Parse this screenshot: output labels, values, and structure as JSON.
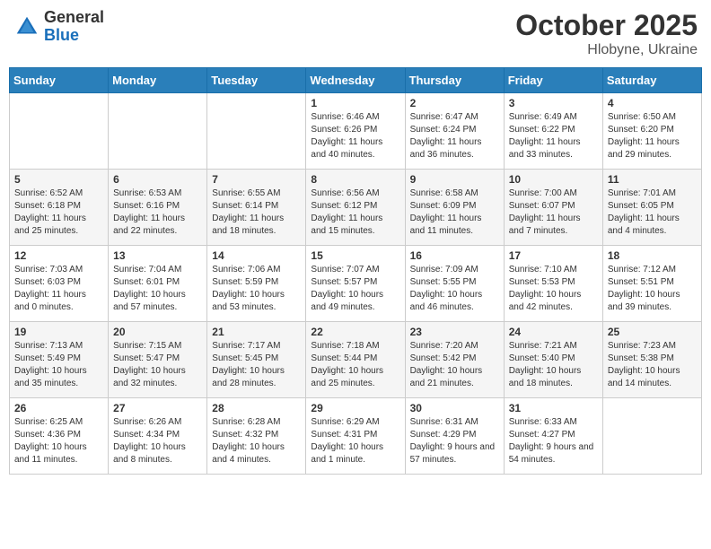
{
  "header": {
    "logo_general": "General",
    "logo_blue": "Blue",
    "month": "October 2025",
    "location": "Hlobyne, Ukraine"
  },
  "weekdays": [
    "Sunday",
    "Monday",
    "Tuesday",
    "Wednesday",
    "Thursday",
    "Friday",
    "Saturday"
  ],
  "weeks": [
    [
      null,
      null,
      null,
      {
        "day": "1",
        "sunrise": "Sunrise: 6:46 AM",
        "sunset": "Sunset: 6:26 PM",
        "daylight": "Daylight: 11 hours and 40 minutes."
      },
      {
        "day": "2",
        "sunrise": "Sunrise: 6:47 AM",
        "sunset": "Sunset: 6:24 PM",
        "daylight": "Daylight: 11 hours and 36 minutes."
      },
      {
        "day": "3",
        "sunrise": "Sunrise: 6:49 AM",
        "sunset": "Sunset: 6:22 PM",
        "daylight": "Daylight: 11 hours and 33 minutes."
      },
      {
        "day": "4",
        "sunrise": "Sunrise: 6:50 AM",
        "sunset": "Sunset: 6:20 PM",
        "daylight": "Daylight: 11 hours and 29 minutes."
      }
    ],
    [
      {
        "day": "5",
        "sunrise": "Sunrise: 6:52 AM",
        "sunset": "Sunset: 6:18 PM",
        "daylight": "Daylight: 11 hours and 25 minutes."
      },
      {
        "day": "6",
        "sunrise": "Sunrise: 6:53 AM",
        "sunset": "Sunset: 6:16 PM",
        "daylight": "Daylight: 11 hours and 22 minutes."
      },
      {
        "day": "7",
        "sunrise": "Sunrise: 6:55 AM",
        "sunset": "Sunset: 6:14 PM",
        "daylight": "Daylight: 11 hours and 18 minutes."
      },
      {
        "day": "8",
        "sunrise": "Sunrise: 6:56 AM",
        "sunset": "Sunset: 6:12 PM",
        "daylight": "Daylight: 11 hours and 15 minutes."
      },
      {
        "day": "9",
        "sunrise": "Sunrise: 6:58 AM",
        "sunset": "Sunset: 6:09 PM",
        "daylight": "Daylight: 11 hours and 11 minutes."
      },
      {
        "day": "10",
        "sunrise": "Sunrise: 7:00 AM",
        "sunset": "Sunset: 6:07 PM",
        "daylight": "Daylight: 11 hours and 7 minutes."
      },
      {
        "day": "11",
        "sunrise": "Sunrise: 7:01 AM",
        "sunset": "Sunset: 6:05 PM",
        "daylight": "Daylight: 11 hours and 4 minutes."
      }
    ],
    [
      {
        "day": "12",
        "sunrise": "Sunrise: 7:03 AM",
        "sunset": "Sunset: 6:03 PM",
        "daylight": "Daylight: 11 hours and 0 minutes."
      },
      {
        "day": "13",
        "sunrise": "Sunrise: 7:04 AM",
        "sunset": "Sunset: 6:01 PM",
        "daylight": "Daylight: 10 hours and 57 minutes."
      },
      {
        "day": "14",
        "sunrise": "Sunrise: 7:06 AM",
        "sunset": "Sunset: 5:59 PM",
        "daylight": "Daylight: 10 hours and 53 minutes."
      },
      {
        "day": "15",
        "sunrise": "Sunrise: 7:07 AM",
        "sunset": "Sunset: 5:57 PM",
        "daylight": "Daylight: 10 hours and 49 minutes."
      },
      {
        "day": "16",
        "sunrise": "Sunrise: 7:09 AM",
        "sunset": "Sunset: 5:55 PM",
        "daylight": "Daylight: 10 hours and 46 minutes."
      },
      {
        "day": "17",
        "sunrise": "Sunrise: 7:10 AM",
        "sunset": "Sunset: 5:53 PM",
        "daylight": "Daylight: 10 hours and 42 minutes."
      },
      {
        "day": "18",
        "sunrise": "Sunrise: 7:12 AM",
        "sunset": "Sunset: 5:51 PM",
        "daylight": "Daylight: 10 hours and 39 minutes."
      }
    ],
    [
      {
        "day": "19",
        "sunrise": "Sunrise: 7:13 AM",
        "sunset": "Sunset: 5:49 PM",
        "daylight": "Daylight: 10 hours and 35 minutes."
      },
      {
        "day": "20",
        "sunrise": "Sunrise: 7:15 AM",
        "sunset": "Sunset: 5:47 PM",
        "daylight": "Daylight: 10 hours and 32 minutes."
      },
      {
        "day": "21",
        "sunrise": "Sunrise: 7:17 AM",
        "sunset": "Sunset: 5:45 PM",
        "daylight": "Daylight: 10 hours and 28 minutes."
      },
      {
        "day": "22",
        "sunrise": "Sunrise: 7:18 AM",
        "sunset": "Sunset: 5:44 PM",
        "daylight": "Daylight: 10 hours and 25 minutes."
      },
      {
        "day": "23",
        "sunrise": "Sunrise: 7:20 AM",
        "sunset": "Sunset: 5:42 PM",
        "daylight": "Daylight: 10 hours and 21 minutes."
      },
      {
        "day": "24",
        "sunrise": "Sunrise: 7:21 AM",
        "sunset": "Sunset: 5:40 PM",
        "daylight": "Daylight: 10 hours and 18 minutes."
      },
      {
        "day": "25",
        "sunrise": "Sunrise: 7:23 AM",
        "sunset": "Sunset: 5:38 PM",
        "daylight": "Daylight: 10 hours and 14 minutes."
      }
    ],
    [
      {
        "day": "26",
        "sunrise": "Sunrise: 6:25 AM",
        "sunset": "Sunset: 4:36 PM",
        "daylight": "Daylight: 10 hours and 11 minutes."
      },
      {
        "day": "27",
        "sunrise": "Sunrise: 6:26 AM",
        "sunset": "Sunset: 4:34 PM",
        "daylight": "Daylight: 10 hours and 8 minutes."
      },
      {
        "day": "28",
        "sunrise": "Sunrise: 6:28 AM",
        "sunset": "Sunset: 4:32 PM",
        "daylight": "Daylight: 10 hours and 4 minutes."
      },
      {
        "day": "29",
        "sunrise": "Sunrise: 6:29 AM",
        "sunset": "Sunset: 4:31 PM",
        "daylight": "Daylight: 10 hours and 1 minute."
      },
      {
        "day": "30",
        "sunrise": "Sunrise: 6:31 AM",
        "sunset": "Sunset: 4:29 PM",
        "daylight": "Daylight: 9 hours and 57 minutes."
      },
      {
        "day": "31",
        "sunrise": "Sunrise: 6:33 AM",
        "sunset": "Sunset: 4:27 PM",
        "daylight": "Daylight: 9 hours and 54 minutes."
      },
      null
    ]
  ]
}
